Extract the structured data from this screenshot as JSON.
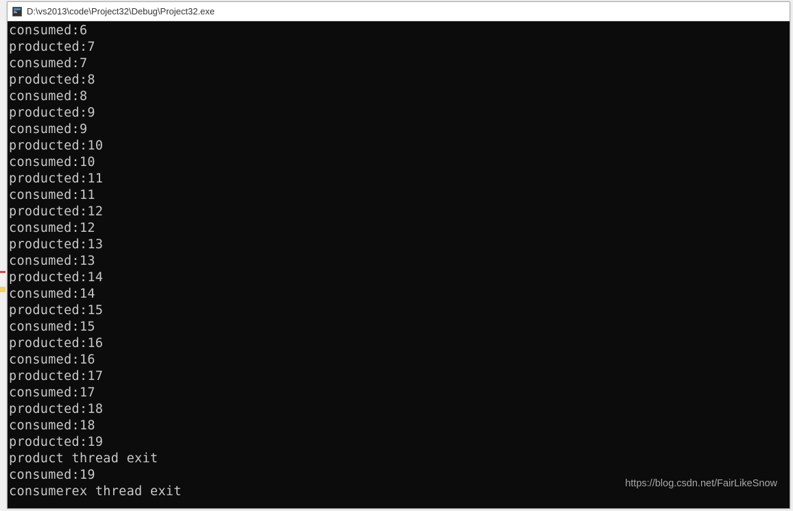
{
  "window": {
    "title": "D:\\vs2013\\code\\Project32\\Debug\\Project32.exe",
    "icon_name": "console-app-icon"
  },
  "console": {
    "lines": [
      "consumed:6",
      "producted:7",
      "consumed:7",
      "producted:8",
      "consumed:8",
      "producted:9",
      "consumed:9",
      "producted:10",
      "consumed:10",
      "producted:11",
      "consumed:11",
      "producted:12",
      "consumed:12",
      "producted:13",
      "consumed:13",
      "producted:14",
      "consumed:14",
      "producted:15",
      "consumed:15",
      "producted:16",
      "consumed:16",
      "producted:17",
      "consumed:17",
      "producted:18",
      "consumed:18",
      "producted:19",
      "product thread exit",
      "consumed:19",
      "consumerex thread exit"
    ]
  },
  "watermark": "https://blog.csdn.net/FairLikeSnow"
}
